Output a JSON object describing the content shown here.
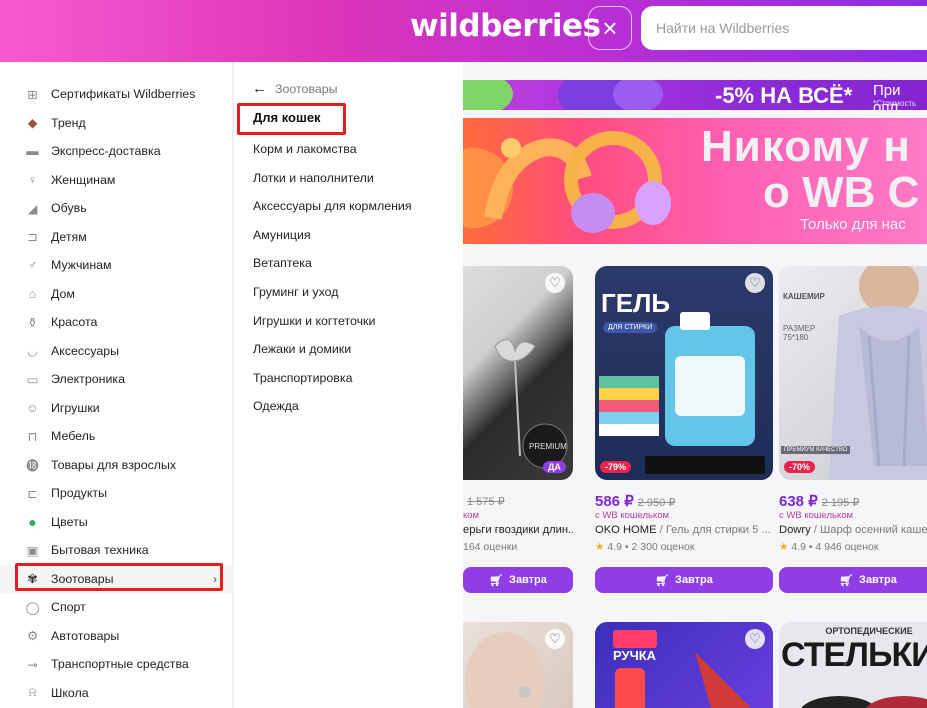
{
  "header": {
    "logo": "wildberries",
    "close_icon": "×",
    "search_placeholder": "Найти на Wildberries"
  },
  "sidebar": {
    "items": [
      {
        "label": "Сертификаты Wildberries",
        "icon": "gift-icon"
      },
      {
        "label": "Тренд",
        "icon": "diamond-icon"
      },
      {
        "label": "Экспресс-доставка",
        "icon": "truck-icon"
      },
      {
        "label": "Женщинам",
        "icon": "woman-icon"
      },
      {
        "label": "Обувь",
        "icon": "shoe-icon"
      },
      {
        "label": "Детям",
        "icon": "stroller-icon"
      },
      {
        "label": "Мужчинам",
        "icon": "man-icon"
      },
      {
        "label": "Дом",
        "icon": "home-icon"
      },
      {
        "label": "Красота",
        "icon": "cosmetics-icon"
      },
      {
        "label": "Аксессуары",
        "icon": "bag-icon"
      },
      {
        "label": "Электроника",
        "icon": "electronics-icon"
      },
      {
        "label": "Игрушки",
        "icon": "teddy-icon"
      },
      {
        "label": "Мебель",
        "icon": "sofa-icon"
      },
      {
        "label": "Товары для взрослых",
        "icon": "18plus-icon"
      },
      {
        "label": "Продукты",
        "icon": "jar-icon"
      },
      {
        "label": "Цветы",
        "icon": "new-badge-icon"
      },
      {
        "label": "Бытовая техника",
        "icon": "appliance-icon"
      },
      {
        "label": "Зоотовары",
        "icon": "paw-icon",
        "active": true
      },
      {
        "label": "Спорт",
        "icon": "ball-icon"
      },
      {
        "label": "Автотовары",
        "icon": "gear-icon"
      },
      {
        "label": "Транспортные средства",
        "icon": "scooter-icon"
      },
      {
        "label": "Школа",
        "icon": "bell-icon"
      }
    ],
    "chevron": "›"
  },
  "submenu": {
    "back_label": "Зоотовары",
    "title": "Для кошек",
    "items": [
      "Корм и лакомства",
      "Лотки и наполнители",
      "Аксессуары для кормления",
      "Амуниция",
      "Ветаптека",
      "Груминг и уход",
      "Игрушки и когтеточки",
      "Лежаки и домики",
      "Транспортировка",
      "Одежда"
    ]
  },
  "banners": {
    "promo_top": "-5% НА ВСЁ*",
    "promo_top_right": "При опл",
    "promo_top_note": "*Стоимость",
    "hero_line1": "Никому н",
    "hero_line2": "о WB С",
    "hero_line3": "Только для нас"
  },
  "products": [
    {
      "discount": "ДА",
      "price": "",
      "old_price": "1 575 ₽",
      "wallet": "ком",
      "brand": "",
      "name": "ерьги гвоздики длин...",
      "rating": "",
      "reviews": "164 оценки",
      "button": "Завтра"
    },
    {
      "discount": "-79%",
      "price": "586 ₽",
      "old_price": "2 950 ₽",
      "wallet": "с WB кошельком",
      "brand": "OKO HOME",
      "name": " / Гель для стирки 5 ...",
      "rating": "4.9",
      "reviews": "2 300 оценок",
      "button": "Завтра"
    },
    {
      "discount": "-70%",
      "price": "638 ₽",
      "old_price": "2 195 ₽",
      "wallet": "с WB кошельком",
      "brand": "Dowry",
      "name": " / Шарф осенний кашем...",
      "rating": "4.9",
      "reviews": "4 946 оценок",
      "button": "Завтра"
    }
  ],
  "product_labels": {
    "gel": "ГЕЛЬ",
    "gel_sub": "ДЛЯ СТИРКИ",
    "cashmere": "КАШЕМИР",
    "size": "РАЗМЕР 75*180",
    "premium_quality": "ПРЕМИУМ КАЧЕСТВО",
    "premium": "PREMIUM",
    "pen": "РУЧКА",
    "ortho": "ОРТОПЕДИЧЕСКИЕ",
    "insoles": "СТЕЛЬКИ"
  },
  "colors": {
    "accent": "#8e3ee4",
    "price": "#7b2ad6",
    "highlight": "#e41d1d",
    "discount": "#e8244d"
  }
}
